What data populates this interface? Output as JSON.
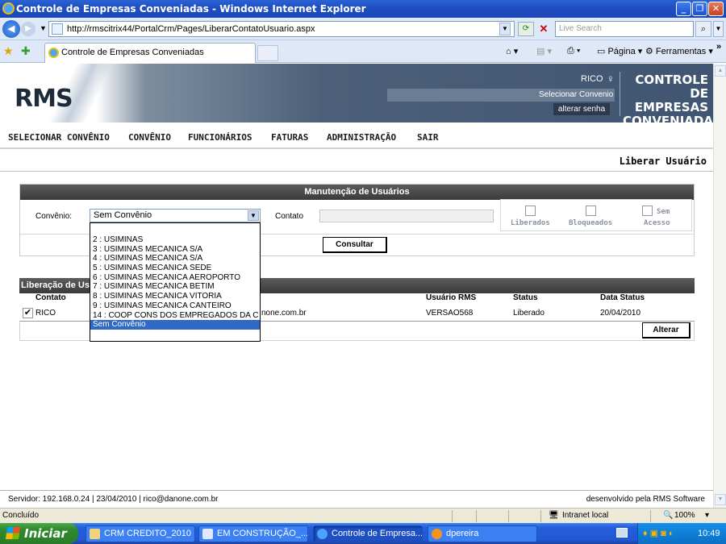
{
  "window": {
    "title": "Controle de Empresas Conveniadas - Windows Internet Explorer"
  },
  "browser": {
    "url": "http://rmscitrix44/PortalCrm/Pages/LiberarContatoUsuario.aspx",
    "search_placeholder": "Live Search",
    "tab_title": "Controle de Empresas Conveniadas",
    "cmd_page": "Página",
    "cmd_tools": "Ferramentas"
  },
  "header": {
    "logo": "RMS",
    "user": "RICO",
    "select_link": "Selecionar Convenio",
    "change_password": "alterar senha",
    "brand_line1": "CONTROLE",
    "brand_line2": "DE EMPRESAS",
    "brand_line3": "CONVENIADAS"
  },
  "menu": {
    "items": [
      "SELECIONAR CONVÊNIO",
      "CONVÊNIO",
      "FUNCIONÁRIOS",
      "FATURAS",
      "ADMINISTRAÇÃO",
      "SAIR"
    ]
  },
  "page_title": "Liberar Usuário",
  "maint": {
    "heading": "Manutenção de Usuários",
    "convenio_label": "Convênio:",
    "convenio_value": "Sem Convênio",
    "contato_label": "Contato",
    "chk_liberados": "Liberados",
    "chk_bloqueados": "Bloqueados",
    "chk_sem": "Sem",
    "chk_acesso": "Acesso",
    "search_button": "Consultar"
  },
  "dropdown": {
    "options": [
      "2 : USIMINAS",
      "3 : USIMINAS MECANICA S/A",
      "4 : USIMINAS MECANICA S/A",
      "5 : USIMINAS MECANICA SEDE",
      "6 : USIMINAS MECANICA AEROPORTO",
      "7 : USIMINAS MECANICA BETIM",
      "8 : USIMINAS MECANICA VITORIA",
      "9 : USIMINAS MECANICA CANTEIRO",
      "14 : COOP CONS DOS EMPREGADOS DA C",
      "Sem Convênio"
    ],
    "selected_index": 9
  },
  "grid": {
    "heading": "Liberação de Usu",
    "columns": [
      "Contato",
      "Usuário RMS",
      "Status",
      "Data Status"
    ],
    "rows": [
      {
        "contato": "RICO",
        "email": "none.com.br",
        "usuario": "VERSAO568",
        "status": "Liberado",
        "data": "20/04/2010",
        "checked": true
      }
    ],
    "alter_button": "Alterar"
  },
  "footer": {
    "left": "Servidor: 192.168.0.24   |   23/04/2010   |   rico@danone.com.br",
    "right": "desenvolvido pela RMS Software"
  },
  "statusbar": {
    "left": "Concluído",
    "zone": "Intranet local",
    "zoom": "100%"
  },
  "taskbar": {
    "start": "Iniciar",
    "tasks": [
      "CRM CREDITO_2010",
      "EM CONSTRUÇÃO_...",
      "Controle de Empresa...",
      "dpereira"
    ],
    "clock": "10:49"
  }
}
